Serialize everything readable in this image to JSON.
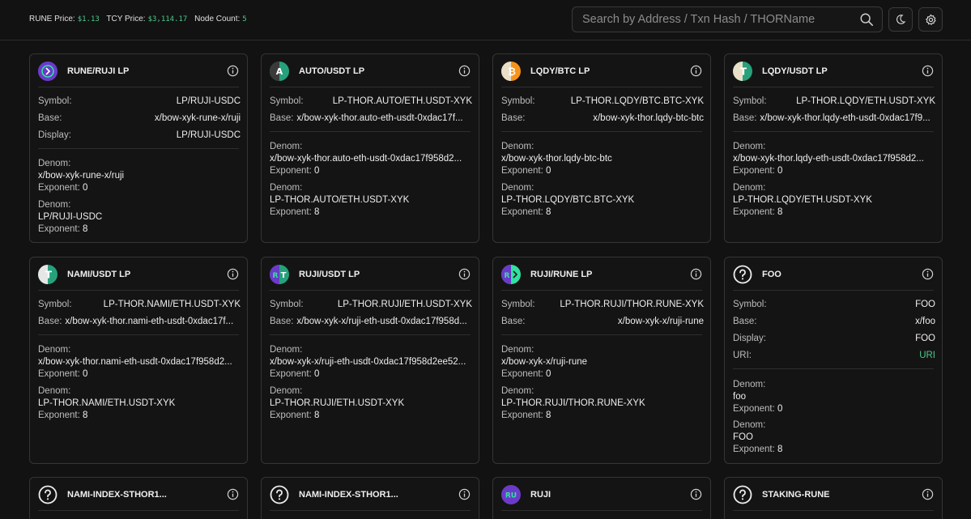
{
  "header": {
    "rune_price_label": "RUNE Price:",
    "rune_price": "$1.13",
    "tcy_price_label": "TCY Price:",
    "tcy_price": "$3,114.17",
    "node_count_label": "Node Count:",
    "node_count": "5",
    "search_placeholder": "Search by Address / Txn Hash / THORName",
    "icons": {
      "search": "search-icon",
      "theme": "moon-icon",
      "settings": "gear-icon"
    }
  },
  "labels": {
    "symbol": "Symbol:",
    "base": "Base:",
    "display": "Display:",
    "uri": "URI:",
    "denom": "Denom:",
    "exponent": "Exponent:"
  },
  "colors": {
    "accent": "#4ec98a",
    "background": "#121212",
    "card_border": "#353535"
  },
  "cards": [
    {
      "title": "RUNE/RUJI LP",
      "icon": "rune-ruji-logo",
      "symbol": "LP/RUJI-USDC",
      "base": "x/bow-xyk-rune-x/ruji",
      "display": "LP/RUJI-USDC",
      "denom_units": [
        {
          "denom": "x/bow-xyk-rune-x/ruji",
          "exponent": "0"
        },
        {
          "denom": "LP/RUJI-USDC",
          "exponent": "8"
        }
      ]
    },
    {
      "title": "AUTO/USDT LP",
      "icon": "auto-usdt-logo",
      "symbol": "LP-THOR.AUTO/ETH.USDT-XYK",
      "base": "x/bow-xyk-thor.auto-eth-usdt-0xdac17f...",
      "denom_units": [
        {
          "denom": "x/bow-xyk-thor.auto-eth-usdt-0xdac17f958d2...",
          "exponent": "0"
        },
        {
          "denom": "LP-THOR.AUTO/ETH.USDT-XYK",
          "exponent": "8"
        }
      ]
    },
    {
      "title": "LQDY/BTC LP",
      "icon": "lqdy-btc-logo",
      "symbol": "LP-THOR.LQDY/BTC.BTC-XYK",
      "base": "x/bow-xyk-thor.lqdy-btc-btc",
      "denom_units": [
        {
          "denom": "x/bow-xyk-thor.lqdy-btc-btc",
          "exponent": "0"
        },
        {
          "denom": "LP-THOR.LQDY/BTC.BTC-XYK",
          "exponent": "8"
        }
      ]
    },
    {
      "title": "LQDY/USDT LP",
      "icon": "lqdy-usdt-logo",
      "symbol": "LP-THOR.LQDY/ETH.USDT-XYK",
      "base": "x/bow-xyk-thor.lqdy-eth-usdt-0xdac17f9...",
      "denom_units": [
        {
          "denom": "x/bow-xyk-thor.lqdy-eth-usdt-0xdac17f958d2...",
          "exponent": "0"
        },
        {
          "denom": "LP-THOR.LQDY/ETH.USDT-XYK",
          "exponent": "8"
        }
      ]
    },
    {
      "title": "NAMI/USDT LP",
      "icon": "nami-usdt-logo",
      "symbol": "LP-THOR.NAMI/ETH.USDT-XYK",
      "base": "x/bow-xyk-thor.nami-eth-usdt-0xdac17f...",
      "denom_units": [
        {
          "denom": "x/bow-xyk-thor.nami-eth-usdt-0xdac17f958d2...",
          "exponent": "0"
        },
        {
          "denom": "LP-THOR.NAMI/ETH.USDT-XYK",
          "exponent": "8"
        }
      ]
    },
    {
      "title": "RUJI/USDT LP",
      "icon": "ruji-usdt-logo",
      "symbol": "LP-THOR.RUJI/ETH.USDT-XYK",
      "base": "x/bow-xyk-x/ruji-eth-usdt-0xdac17f958d...",
      "denom_units": [
        {
          "denom": "x/bow-xyk-x/ruji-eth-usdt-0xdac17f958d2ee52...",
          "exponent": "0"
        },
        {
          "denom": "LP-THOR.RUJI/ETH.USDT-XYK",
          "exponent": "8"
        }
      ]
    },
    {
      "title": "RUJI/RUNE LP",
      "icon": "ruji-rune-logo",
      "symbol": "LP-THOR.RUJI/THOR.RUNE-XYK",
      "base": "x/bow-xyk-x/ruji-rune",
      "denom_units": [
        {
          "denom": "x/bow-xyk-x/ruji-rune",
          "exponent": "0"
        },
        {
          "denom": "LP-THOR.RUJI/THOR.RUNE-XYK",
          "exponent": "8"
        }
      ]
    },
    {
      "title": "FOO",
      "icon": "question-circle-icon",
      "symbol": "FOO",
      "base": "x/foo",
      "display": "FOO",
      "uri": "URI",
      "denom_units": [
        {
          "denom": "foo",
          "exponent": "0"
        },
        {
          "denom": "FOO",
          "exponent": "8"
        }
      ]
    },
    {
      "title": "NAMI-INDEX-STHOR1...",
      "icon": "question-circle-icon"
    },
    {
      "title": "NAMI-INDEX-STHOR1...",
      "icon": "question-circle-icon"
    },
    {
      "title": "RUJI",
      "icon": "ruji-logo"
    },
    {
      "title": "STAKING-RUNE",
      "icon": "question-circle-icon"
    }
  ]
}
